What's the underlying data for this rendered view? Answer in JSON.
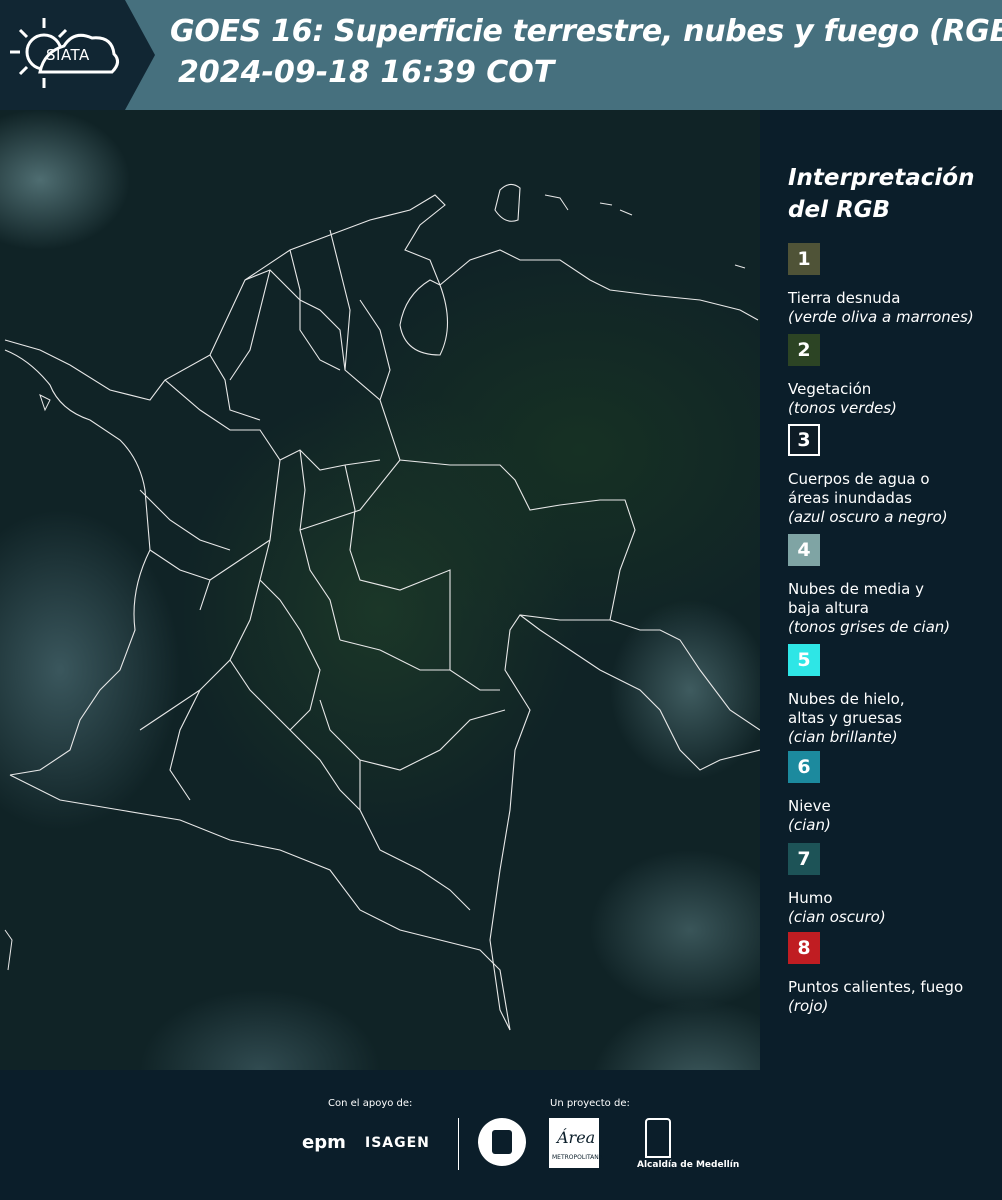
{
  "header": {
    "logo_text": "SIATA",
    "title_line1": "GOES 16: Superficie terrestre, nubes y fuego (RGB)",
    "title_line2": "2024-09-18 16:39 COT",
    "colors": {
      "background": "#46707e",
      "logo_background": "#112633"
    }
  },
  "legend": {
    "title_line1": "Interpretación",
    "title_line2": "del RGB",
    "items": [
      {
        "number": "1",
        "label": "Tierra desnuda",
        "sub": "(verde oliva a marrones)",
        "color": "#4f5337"
      },
      {
        "number": "2",
        "label": "Vegetación",
        "sub": "(tonos verdes)",
        "color": "#2c4424"
      },
      {
        "number": "3",
        "label": "Cuerpos de agua o áreas inundadas",
        "sub": "(azul oscuro a negro)",
        "color": "#0e1c26"
      },
      {
        "number": "4",
        "label": "Nubes de media y baja altura",
        "sub": "(tonos grises de cian)",
        "color": "#7fa4a4"
      },
      {
        "number": "5",
        "label": "Nubes de hielo, altas y gruesas",
        "sub": "(cian brillante)",
        "color": "#2ee6e6"
      },
      {
        "number": "6",
        "label": "Nieve",
        "sub": "(cian)",
        "color": "#1c8a9e"
      },
      {
        "number": "7",
        "label": "Humo",
        "sub": "(cian oscuro)",
        "color": "#1d5357"
      },
      {
        "number": "8",
        "label": "Puntos calientes, fuego",
        "sub": "(rojo)",
        "color": "#c01d22"
      }
    ]
  },
  "footer": {
    "support_label": "Con el apoyo de:",
    "project_label": "Un proyecto de:",
    "epm": "epm",
    "isagen": "ISAGEN",
    "area_logo": "Área",
    "area_sub": "METROPOLITANA",
    "alcaldia": "Alcaldía de Medellín"
  }
}
